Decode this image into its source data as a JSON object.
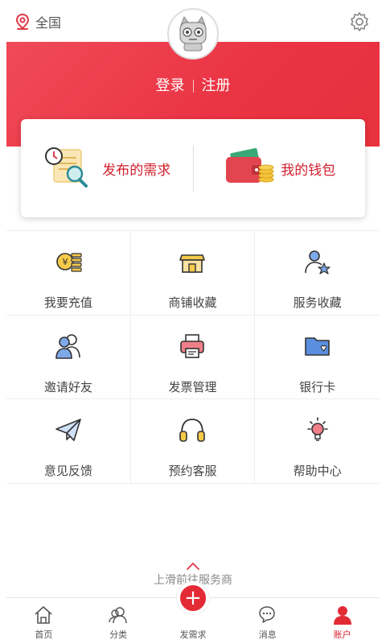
{
  "header": {
    "location_label": "全国",
    "location_icon": "location-pin-icon",
    "settings_icon": "gear-icon"
  },
  "auth": {
    "login_label": "登录",
    "register_label": "注册"
  },
  "card": {
    "left_label": "发布的需求",
    "right_label": "我的钱包"
  },
  "grid": [
    {
      "label": "我要充值",
      "icon": "coin-stack-icon"
    },
    {
      "label": "商铺收藏",
      "icon": "store-icon"
    },
    {
      "label": "服务收藏",
      "icon": "user-star-icon"
    },
    {
      "label": "邀请好友",
      "icon": "users-icon"
    },
    {
      "label": "发票管理",
      "icon": "printer-icon"
    },
    {
      "label": "银行卡",
      "icon": "folder-heart-icon"
    },
    {
      "label": "意见反馈",
      "icon": "paper-plane-icon"
    },
    {
      "label": "预约客服",
      "icon": "headphones-icon"
    },
    {
      "label": "帮助中心",
      "icon": "lightbulb-icon"
    }
  ],
  "hint": {
    "text": "上滑前往服务商"
  },
  "tabs": [
    {
      "label": "首页",
      "icon": "home-icon"
    },
    {
      "label": "分类",
      "icon": "category-icon"
    },
    {
      "label": "发需求",
      "icon": "plus-icon"
    },
    {
      "label": "消息",
      "icon": "chat-icon"
    },
    {
      "label": "账户",
      "icon": "account-icon"
    }
  ],
  "colors": {
    "brand_red": "#e32b36",
    "banner_red": "#ed3a4a",
    "text_gray": "#444444"
  }
}
